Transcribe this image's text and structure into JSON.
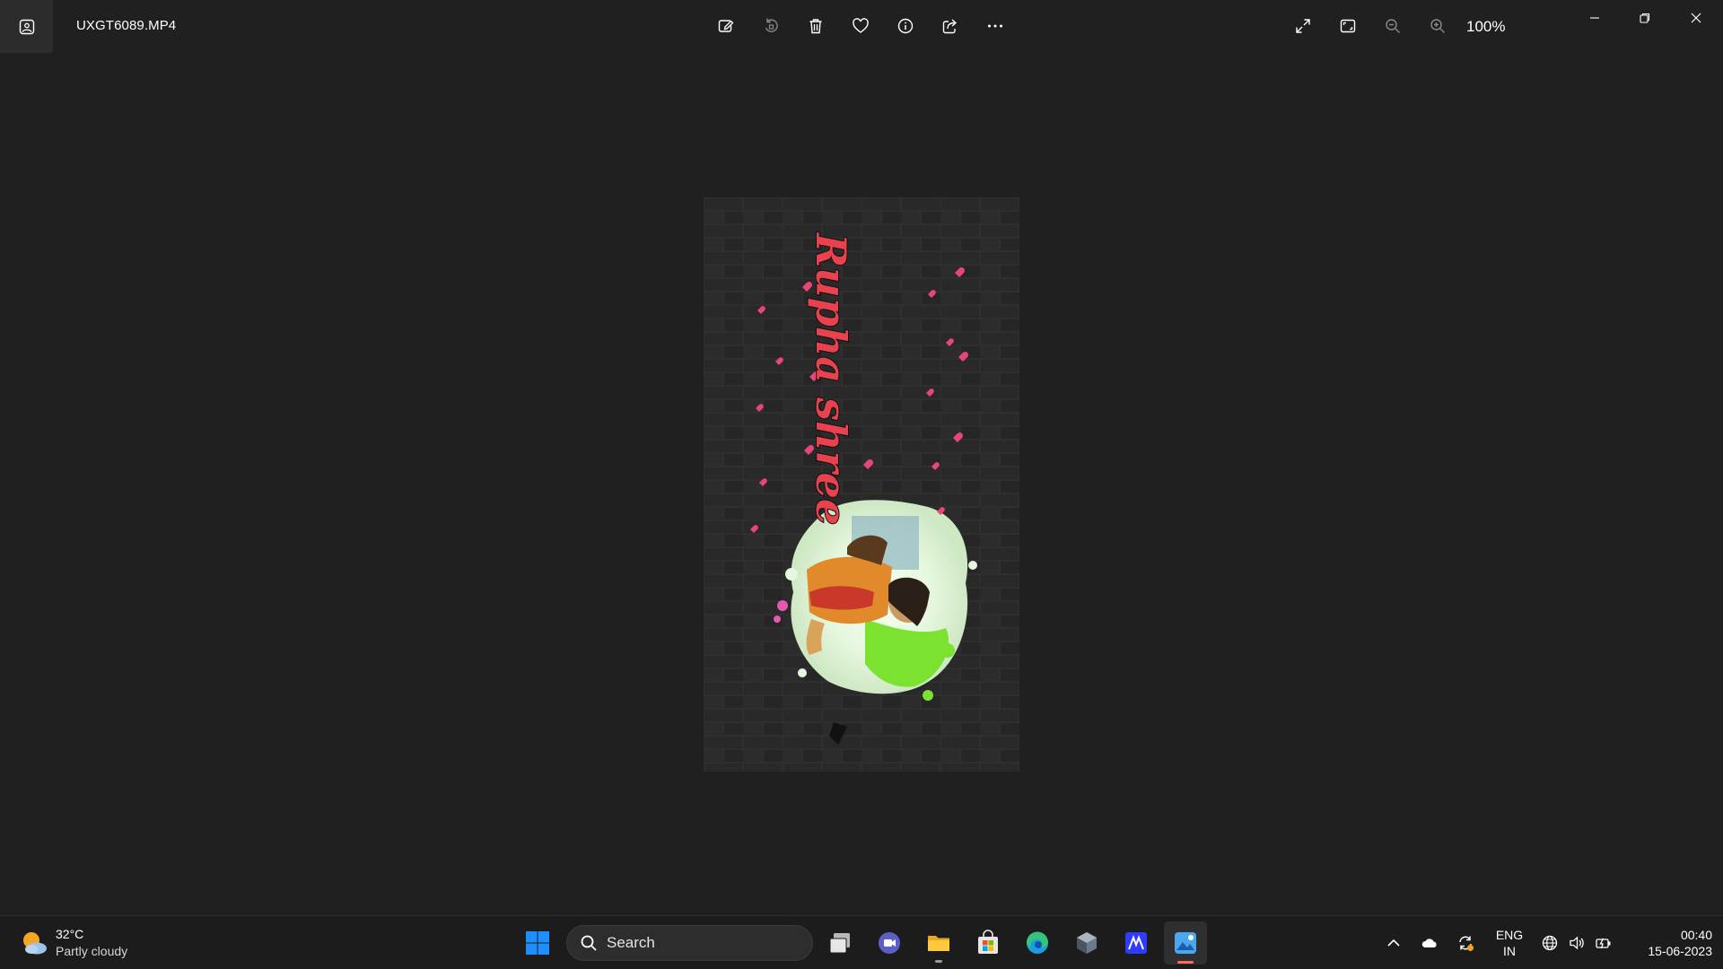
{
  "window": {
    "file_name": "UXGT6089.MP4",
    "zoom_level": "100%"
  },
  "toolbar": {
    "icons": [
      "edit-image-icon",
      "rotate-icon",
      "delete-icon",
      "favorite-heart-icon",
      "info-icon",
      "share-icon",
      "more-options-icon"
    ],
    "view_icons": [
      "fullscreen-icon",
      "fit-to-window-icon",
      "zoom-out-icon",
      "zoom-in-icon"
    ]
  },
  "media": {
    "overlay_text": "Rupha shree",
    "accent_color": "#e8424f",
    "background_color": "#3a3a3a"
  },
  "taskbar": {
    "weather": {
      "temperature": "32°C",
      "condition": "Partly cloudy"
    },
    "search": {
      "label": "Search"
    },
    "apps": [
      "start-icon",
      "task-view-icon",
      "teams-chat-icon",
      "file-explorer-icon",
      "microsoft-store-icon",
      "edge-browser-icon",
      "dev-app-icon",
      "editor-app-icon",
      "photos-app-icon"
    ],
    "tray": {
      "language_line1": "ENG",
      "language_line2": "IN",
      "time": "00:40",
      "date": "15-06-2023"
    }
  },
  "colors": {
    "window_bg": "#202020",
    "taskbar_bg": "#1c1c1c",
    "windows_blue": "#1f8fff",
    "active_indicator": "#ff6b5b"
  }
}
